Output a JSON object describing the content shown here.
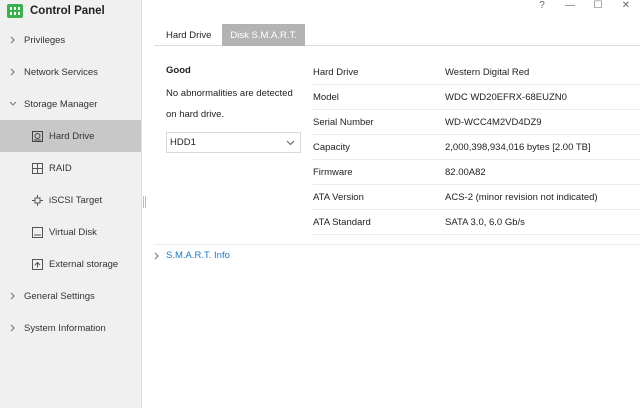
{
  "app": {
    "title": "Control Panel",
    "logo_icon": "control-panel-logo"
  },
  "window_controls": {
    "help": "?",
    "minimize": "—",
    "maximize": "☐",
    "close": "✕"
  },
  "sidebar": {
    "items": [
      {
        "label": "Privileges",
        "icon": "chevron-right-icon"
      },
      {
        "label": "Network Services",
        "icon": "chevron-right-icon"
      },
      {
        "label": "Storage Manager",
        "icon": "chevron-down-icon"
      },
      {
        "label": "General Settings",
        "icon": "chevron-right-icon"
      },
      {
        "label": "System Information",
        "icon": "chevron-right-icon"
      }
    ],
    "storage_children": [
      {
        "label": "Hard Drive",
        "icon": "hard-drive-icon",
        "active": true
      },
      {
        "label": "RAID",
        "icon": "raid-icon"
      },
      {
        "label": "iSCSI Target",
        "icon": "iscsi-icon"
      },
      {
        "label": "Virtual Disk",
        "icon": "virtual-disk-icon"
      },
      {
        "label": "External storage",
        "icon": "external-storage-icon"
      }
    ]
  },
  "tabs": [
    {
      "label": "Hard Drive",
      "active": false
    },
    {
      "label": "Disk S.M.A.R.T.",
      "active": true
    }
  ],
  "status": {
    "title": "Good",
    "line1": "No abnormalities are detected",
    "line2": "on hard drive."
  },
  "drive_select": {
    "value": "HDD1"
  },
  "info": [
    {
      "key": "Hard Drive",
      "value": "Western Digital Red"
    },
    {
      "key": "Model",
      "value": "WDC WD20EFRX-68EUZN0"
    },
    {
      "key": "Serial Number",
      "value": "WD-WCC4M2VD4DZ9"
    },
    {
      "key": "Capacity",
      "value": "2,000,398,934,016 bytes [2.00 TB]"
    },
    {
      "key": "Firmware",
      "value": "82.00A82"
    },
    {
      "key": "ATA Version",
      "value": "ACS-2 (minor revision not indicated)"
    },
    {
      "key": "ATA Standard",
      "value": "SATA 3.0, 6.0 Gb/s"
    }
  ],
  "smart_info": {
    "label": "S.M.A.R.T. Info"
  },
  "colors": {
    "accent_link": "#1a7bd0",
    "active_tab": "#b3b3b3",
    "active_nav": "#c8c8c8",
    "logo": "#37b24d"
  }
}
